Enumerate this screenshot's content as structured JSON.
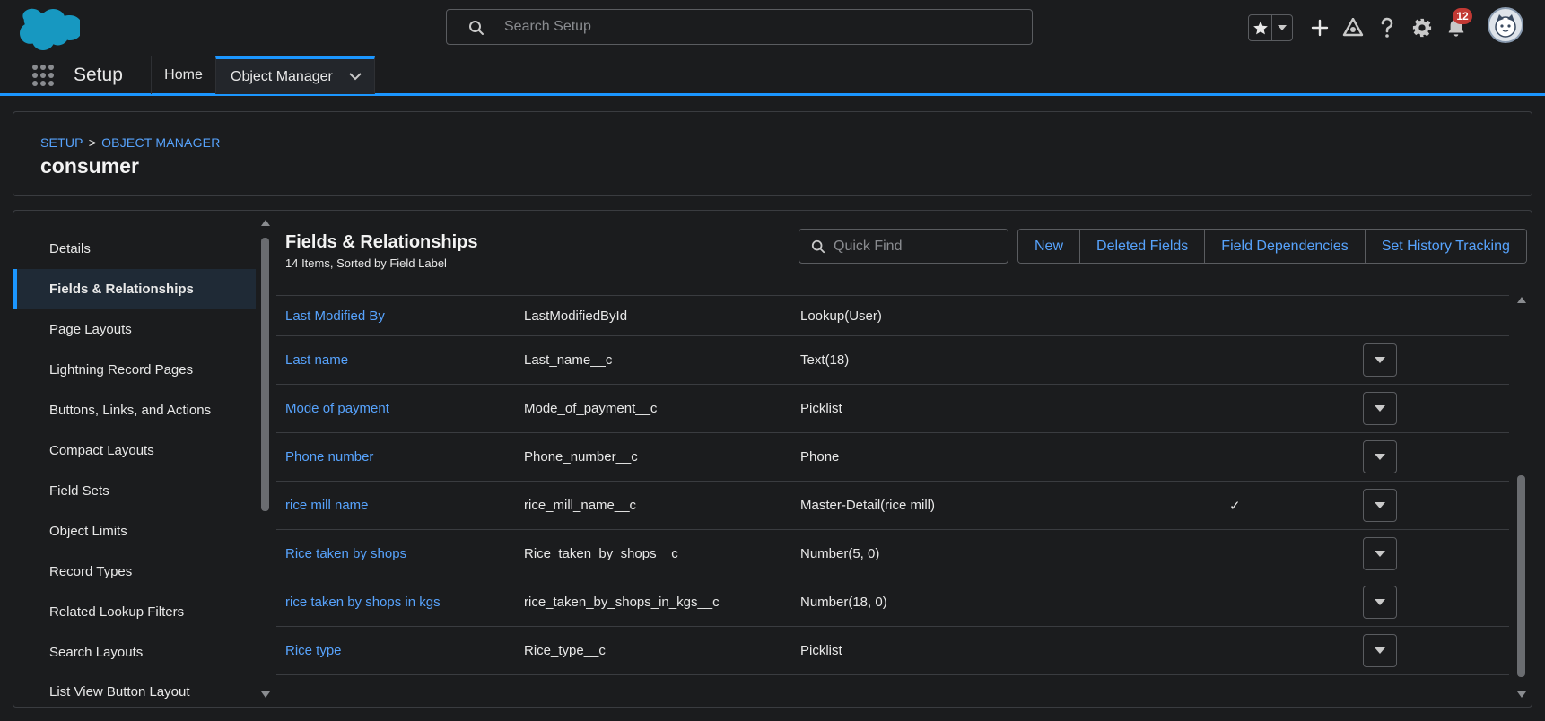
{
  "header": {
    "search_placeholder": "Search Setup",
    "notification_count": "12",
    "icons": [
      "salesforce-cloud-logo",
      "search-icon",
      "star-icon",
      "chevron-down-icon",
      "plus-icon",
      "trailhead-icon",
      "help-icon",
      "gear-icon",
      "bell-icon",
      "avatar"
    ]
  },
  "nav": {
    "app_name": "Setup",
    "tabs": [
      {
        "label": "Home"
      },
      {
        "label": "Object Manager"
      }
    ]
  },
  "page_header": {
    "breadcrumb": [
      "SETUP",
      "OBJECT MANAGER"
    ],
    "breadcrumb_sep": ">",
    "title": "consumer"
  },
  "sidebar": {
    "items": [
      {
        "label": "Details"
      },
      {
        "label": "Fields & Relationships",
        "active": true
      },
      {
        "label": "Page Layouts"
      },
      {
        "label": "Lightning Record Pages"
      },
      {
        "label": "Buttons, Links, and Actions"
      },
      {
        "label": "Compact Layouts"
      },
      {
        "label": "Field Sets"
      },
      {
        "label": "Object Limits"
      },
      {
        "label": "Record Types"
      },
      {
        "label": "Related Lookup Filters"
      },
      {
        "label": "Search Layouts"
      },
      {
        "label": "List View Button Layout"
      }
    ]
  },
  "content": {
    "title": "Fields & Relationships",
    "subtitle": "14 Items, Sorted by Field Label",
    "quick_find_placeholder": "Quick Find",
    "buttons": [
      {
        "label": "New"
      },
      {
        "label": "Deleted Fields"
      },
      {
        "label": "Field Dependencies"
      },
      {
        "label": "Set History Tracking"
      }
    ],
    "rows": [
      {
        "label": "Last Modified By",
        "api": "LastModifiedById",
        "type": "Lookup(User)",
        "indexed": "",
        "has_menu": false
      },
      {
        "label": "Last name",
        "api": "Last_name__c",
        "type": "Text(18)",
        "indexed": "",
        "has_menu": true
      },
      {
        "label": "Mode of payment",
        "api": "Mode_of_payment__c",
        "type": "Picklist",
        "indexed": "",
        "has_menu": true
      },
      {
        "label": "Phone number",
        "api": "Phone_number__c",
        "type": "Phone",
        "indexed": "",
        "has_menu": true
      },
      {
        "label": "rice mill name",
        "api": "rice_mill_name__c",
        "type": "Master-Detail(rice mill)",
        "indexed": "✓",
        "has_menu": true
      },
      {
        "label": "Rice taken by shops",
        "api": "Rice_taken_by_shops__c",
        "type": "Number(5, 0)",
        "indexed": "",
        "has_menu": true
      },
      {
        "label": "rice taken by shops in kgs",
        "api": "rice_taken_by_shops_in_kgs__c",
        "type": "Number(18, 0)",
        "indexed": "",
        "has_menu": true
      },
      {
        "label": "Rice type",
        "api": "Rice_type__c",
        "type": "Picklist",
        "indexed": "",
        "has_menu": true
      }
    ]
  },
  "colors": {
    "background": "#1b1c1e",
    "link": "#57a3fd",
    "accent": "#1b96ff",
    "badge": "#c23934",
    "brand_cloud": "#1798c1"
  }
}
